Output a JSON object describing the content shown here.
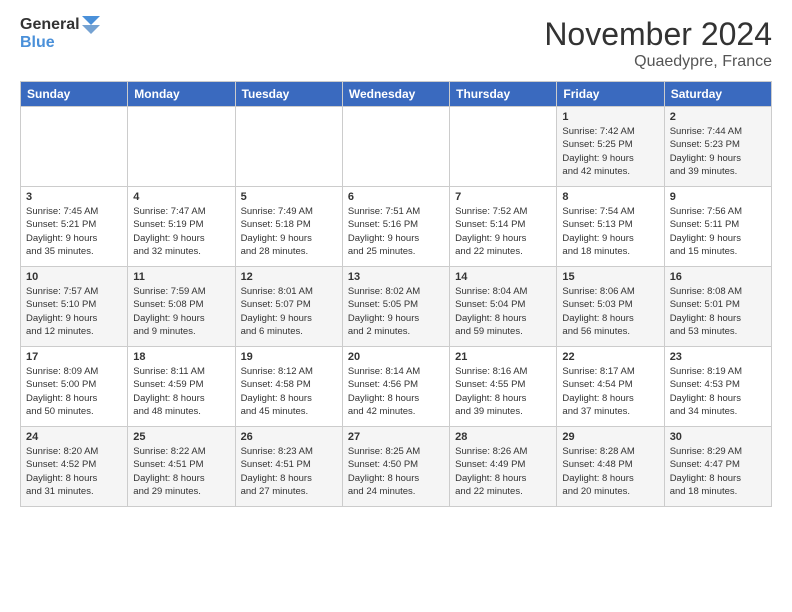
{
  "header": {
    "logo_line1": "General",
    "logo_line2": "Blue",
    "month": "November 2024",
    "location": "Quaedypre, France"
  },
  "weekdays": [
    "Sunday",
    "Monday",
    "Tuesday",
    "Wednesday",
    "Thursday",
    "Friday",
    "Saturday"
  ],
  "weeks": [
    [
      {
        "day": "",
        "info": ""
      },
      {
        "day": "",
        "info": ""
      },
      {
        "day": "",
        "info": ""
      },
      {
        "day": "",
        "info": ""
      },
      {
        "day": "",
        "info": ""
      },
      {
        "day": "1",
        "info": "Sunrise: 7:42 AM\nSunset: 5:25 PM\nDaylight: 9 hours\nand 42 minutes."
      },
      {
        "day": "2",
        "info": "Sunrise: 7:44 AM\nSunset: 5:23 PM\nDaylight: 9 hours\nand 39 minutes."
      }
    ],
    [
      {
        "day": "3",
        "info": "Sunrise: 7:45 AM\nSunset: 5:21 PM\nDaylight: 9 hours\nand 35 minutes."
      },
      {
        "day": "4",
        "info": "Sunrise: 7:47 AM\nSunset: 5:19 PM\nDaylight: 9 hours\nand 32 minutes."
      },
      {
        "day": "5",
        "info": "Sunrise: 7:49 AM\nSunset: 5:18 PM\nDaylight: 9 hours\nand 28 minutes."
      },
      {
        "day": "6",
        "info": "Sunrise: 7:51 AM\nSunset: 5:16 PM\nDaylight: 9 hours\nand 25 minutes."
      },
      {
        "day": "7",
        "info": "Sunrise: 7:52 AM\nSunset: 5:14 PM\nDaylight: 9 hours\nand 22 minutes."
      },
      {
        "day": "8",
        "info": "Sunrise: 7:54 AM\nSunset: 5:13 PM\nDaylight: 9 hours\nand 18 minutes."
      },
      {
        "day": "9",
        "info": "Sunrise: 7:56 AM\nSunset: 5:11 PM\nDaylight: 9 hours\nand 15 minutes."
      }
    ],
    [
      {
        "day": "10",
        "info": "Sunrise: 7:57 AM\nSunset: 5:10 PM\nDaylight: 9 hours\nand 12 minutes."
      },
      {
        "day": "11",
        "info": "Sunrise: 7:59 AM\nSunset: 5:08 PM\nDaylight: 9 hours\nand 9 minutes."
      },
      {
        "day": "12",
        "info": "Sunrise: 8:01 AM\nSunset: 5:07 PM\nDaylight: 9 hours\nand 6 minutes."
      },
      {
        "day": "13",
        "info": "Sunrise: 8:02 AM\nSunset: 5:05 PM\nDaylight: 9 hours\nand 2 minutes."
      },
      {
        "day": "14",
        "info": "Sunrise: 8:04 AM\nSunset: 5:04 PM\nDaylight: 8 hours\nand 59 minutes."
      },
      {
        "day": "15",
        "info": "Sunrise: 8:06 AM\nSunset: 5:03 PM\nDaylight: 8 hours\nand 56 minutes."
      },
      {
        "day": "16",
        "info": "Sunrise: 8:08 AM\nSunset: 5:01 PM\nDaylight: 8 hours\nand 53 minutes."
      }
    ],
    [
      {
        "day": "17",
        "info": "Sunrise: 8:09 AM\nSunset: 5:00 PM\nDaylight: 8 hours\nand 50 minutes."
      },
      {
        "day": "18",
        "info": "Sunrise: 8:11 AM\nSunset: 4:59 PM\nDaylight: 8 hours\nand 48 minutes."
      },
      {
        "day": "19",
        "info": "Sunrise: 8:12 AM\nSunset: 4:58 PM\nDaylight: 8 hours\nand 45 minutes."
      },
      {
        "day": "20",
        "info": "Sunrise: 8:14 AM\nSunset: 4:56 PM\nDaylight: 8 hours\nand 42 minutes."
      },
      {
        "day": "21",
        "info": "Sunrise: 8:16 AM\nSunset: 4:55 PM\nDaylight: 8 hours\nand 39 minutes."
      },
      {
        "day": "22",
        "info": "Sunrise: 8:17 AM\nSunset: 4:54 PM\nDaylight: 8 hours\nand 37 minutes."
      },
      {
        "day": "23",
        "info": "Sunrise: 8:19 AM\nSunset: 4:53 PM\nDaylight: 8 hours\nand 34 minutes."
      }
    ],
    [
      {
        "day": "24",
        "info": "Sunrise: 8:20 AM\nSunset: 4:52 PM\nDaylight: 8 hours\nand 31 minutes."
      },
      {
        "day": "25",
        "info": "Sunrise: 8:22 AM\nSunset: 4:51 PM\nDaylight: 8 hours\nand 29 minutes."
      },
      {
        "day": "26",
        "info": "Sunrise: 8:23 AM\nSunset: 4:51 PM\nDaylight: 8 hours\nand 27 minutes."
      },
      {
        "day": "27",
        "info": "Sunrise: 8:25 AM\nSunset: 4:50 PM\nDaylight: 8 hours\nand 24 minutes."
      },
      {
        "day": "28",
        "info": "Sunrise: 8:26 AM\nSunset: 4:49 PM\nDaylight: 8 hours\nand 22 minutes."
      },
      {
        "day": "29",
        "info": "Sunrise: 8:28 AM\nSunset: 4:48 PM\nDaylight: 8 hours\nand 20 minutes."
      },
      {
        "day": "30",
        "info": "Sunrise: 8:29 AM\nSunset: 4:47 PM\nDaylight: 8 hours\nand 18 minutes."
      }
    ]
  ]
}
